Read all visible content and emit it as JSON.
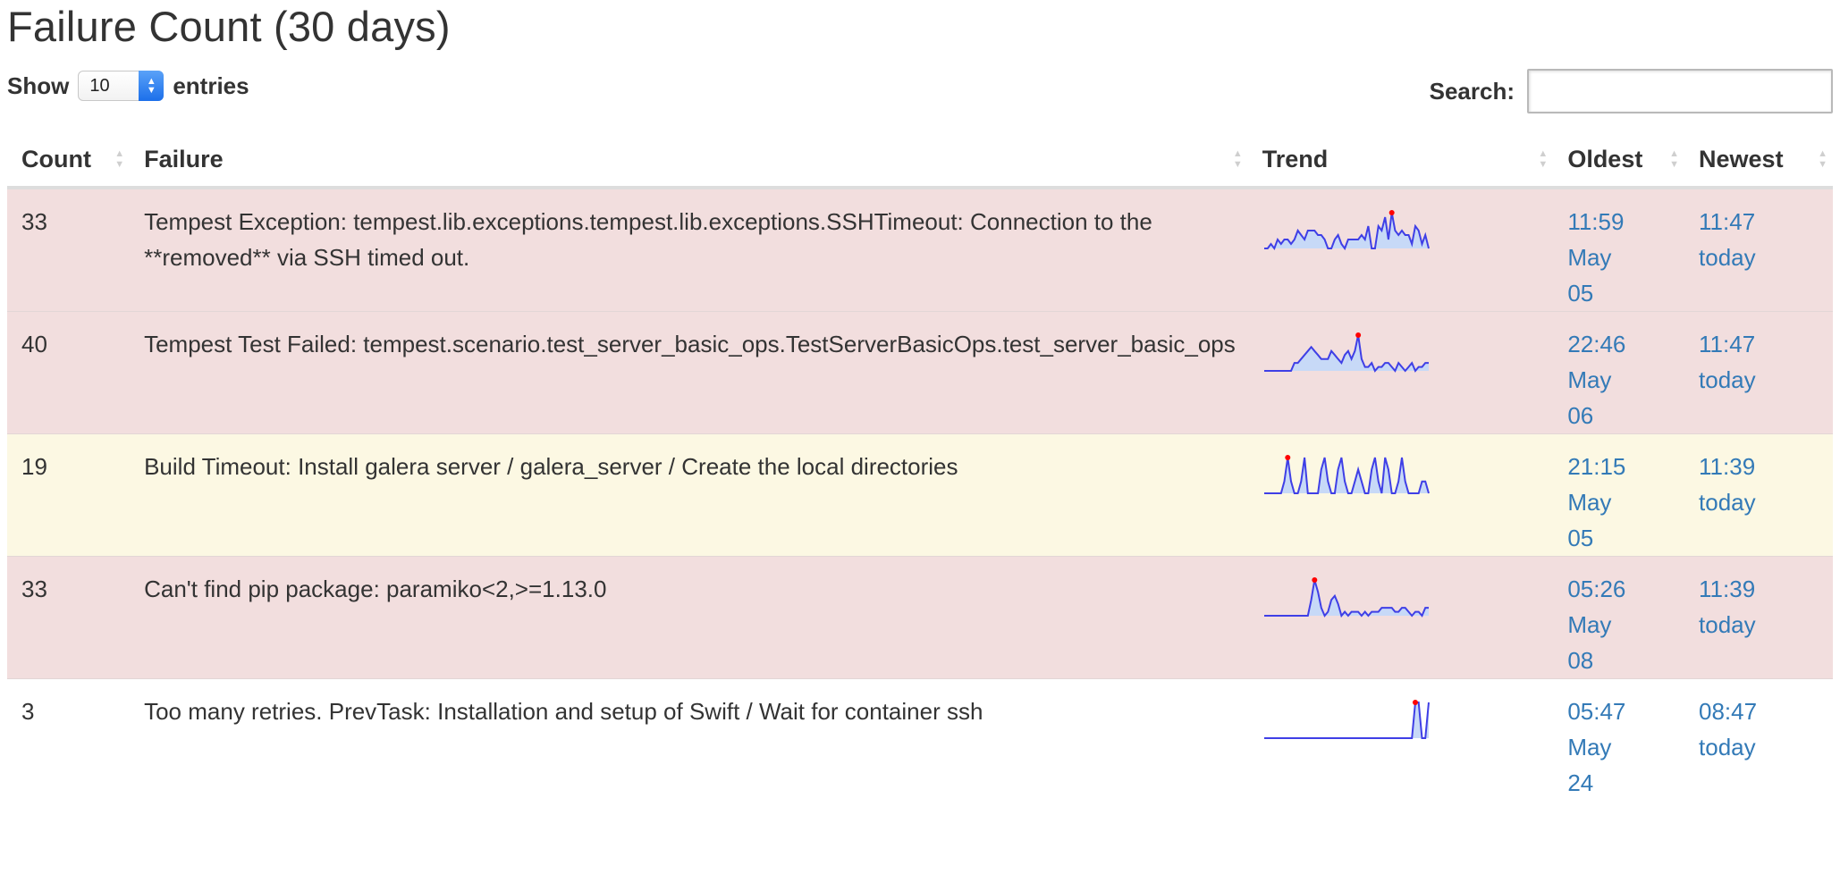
{
  "title": "Failure Count (30 days)",
  "length_control": {
    "show_label": "Show",
    "value": "10",
    "entries_label": "entries"
  },
  "search": {
    "label": "Search:",
    "value": "",
    "placeholder": ""
  },
  "columns": {
    "count": "Count",
    "failure": "Failure",
    "trend": "Trend",
    "oldest": "Oldest",
    "newest": "Newest"
  },
  "colors": {
    "danger_row": "#f2dede",
    "warning_row": "#fcf8e3",
    "link": "#337ab7",
    "sparkline": "#3f3fe6",
    "sparkline_fill": "#c7d9f7",
    "sparkline_peak": "#ff0000"
  },
  "rows": [
    {
      "count": "33",
      "failure": "Tempest Exception: tempest.lib.exceptions.tempest.lib.exceptions.SSHTimeout: Connection to the **removed** via SSH timed out.",
      "oldest": {
        "time": "11:59",
        "month": "May",
        "day": "05"
      },
      "newest": {
        "time": "11:47",
        "day": "today"
      },
      "status": "danger",
      "trend": [
        0,
        0,
        1,
        0,
        2,
        1,
        2,
        2,
        1,
        2,
        4,
        3,
        2,
        4,
        4,
        4,
        3,
        3,
        2,
        0,
        0,
        2,
        3,
        1,
        0,
        2,
        2,
        2,
        2,
        3,
        2,
        5,
        0,
        0,
        5,
        4,
        7,
        2,
        8,
        4,
        3,
        4,
        3,
        3,
        1,
        5,
        4,
        1,
        3,
        0
      ]
    },
    {
      "count": "40",
      "failure": "Tempest Test Failed: tempest.scenario.test_server_basic_ops.TestServerBasicOps.test_server_basic_ops",
      "oldest": {
        "time": "22:46",
        "month": "May",
        "day": "06"
      },
      "newest": {
        "time": "11:47",
        "day": "today"
      },
      "status": "danger",
      "trend": [
        0,
        0,
        0,
        0,
        0,
        0,
        0,
        0,
        0,
        2,
        2,
        3,
        4,
        5,
        6,
        5,
        4,
        3,
        3,
        3,
        5,
        4,
        3,
        2,
        4,
        5,
        3,
        5,
        9,
        3,
        1,
        1,
        2,
        0,
        1,
        1,
        2,
        2,
        1,
        0,
        2,
        1,
        0,
        1,
        2,
        0,
        1,
        1,
        2,
        2
      ]
    },
    {
      "count": "19",
      "failure": "Build Timeout: Install galera server / galera_server / Create the local directories",
      "oldest": {
        "time": "21:15",
        "month": "May",
        "day": "05"
      },
      "newest": {
        "time": "11:39",
        "day": "today"
      },
      "status": "warning",
      "trend": [
        0,
        0,
        0,
        0,
        0,
        0,
        1,
        3,
        1,
        0,
        0,
        1,
        3,
        0,
        0,
        0,
        0,
        2,
        3,
        1,
        0,
        0,
        2,
        3,
        1,
        0,
        0,
        1,
        2,
        1,
        0,
        0,
        2,
        3,
        1,
        0,
        3,
        2,
        0,
        0,
        1,
        3,
        1,
        0,
        0,
        0,
        0,
        1,
        1,
        0
      ]
    },
    {
      "count": "33",
      "failure": "Can't find pip package: paramiko<2,>=1.13.0",
      "oldest": {
        "time": "05:26",
        "month": "May",
        "day": "08"
      },
      "newest": {
        "time": "11:39",
        "day": "today"
      },
      "status": "danger",
      "trend": [
        0,
        0,
        0,
        0,
        0,
        0,
        0,
        0,
        0,
        0,
        0,
        0,
        0,
        0,
        4,
        9,
        6,
        2,
        0,
        1,
        4,
        5,
        3,
        0,
        1,
        0,
        1,
        1,
        1,
        0,
        1,
        0,
        1,
        1,
        1,
        2,
        2,
        2,
        2,
        1,
        1,
        2,
        2,
        1,
        0,
        1,
        1,
        0,
        2,
        2
      ]
    },
    {
      "count": "3",
      "failure": "Too many retries. PrevTask: Installation and setup of Swift / Wait for container ssh",
      "oldest": {
        "time": "05:47",
        "month": "May",
        "day": "24"
      },
      "newest": {
        "time": "08:47",
        "day": "today"
      },
      "status": "plain",
      "trend": [
        0,
        0,
        0,
        0,
        0,
        0,
        0,
        0,
        0,
        0,
        0,
        0,
        0,
        0,
        0,
        0,
        0,
        0,
        0,
        0,
        0,
        0,
        0,
        0,
        0,
        0,
        0,
        0,
        0,
        0,
        0,
        0,
        0,
        0,
        0,
        0,
        0,
        0,
        0,
        0,
        0,
        0,
        0,
        0,
        0,
        1,
        1,
        0,
        0,
        1
      ]
    }
  ]
}
